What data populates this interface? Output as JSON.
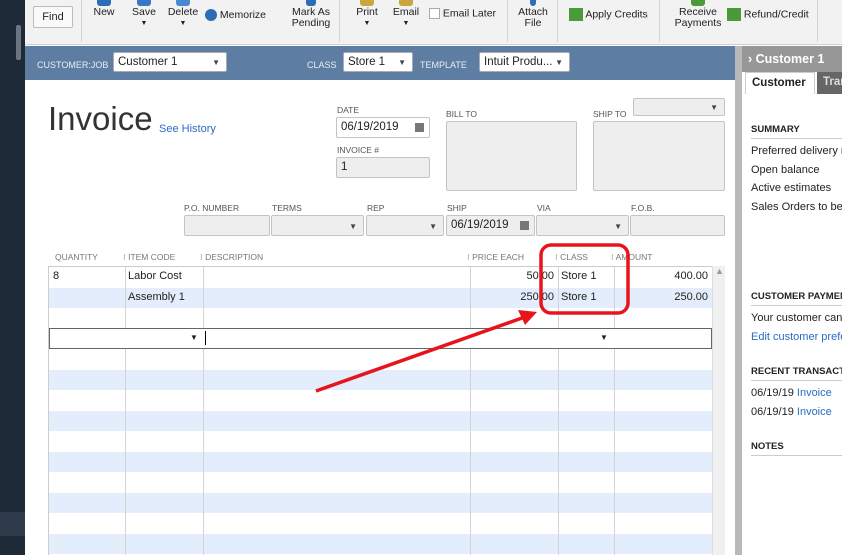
{
  "toolbar": {
    "find": "Find",
    "new": "New",
    "save": "Save",
    "delete": "Delete",
    "memorize": "Memorize",
    "mark_as_pending": [
      "Mark As",
      "Pending"
    ],
    "print": "Print",
    "email": "Email",
    "email_later": "Email Later",
    "attach_file": [
      "Attach",
      "File"
    ],
    "apply_credits": "Apply Credits",
    "receive_payments": [
      "Receive",
      "Payments"
    ],
    "refund_credit": "Refund/Credit"
  },
  "header": {
    "customer_job_label": "CUSTOMER:JOB",
    "customer_job": "Customer 1",
    "class_label": "CLASS",
    "class": "Store 1",
    "template_label": "TEMPLATE",
    "template": "Intuit Produ..."
  },
  "form": {
    "title": "Invoice",
    "see_history": "See History",
    "date_label": "DATE",
    "date": "06/19/2019",
    "invoice_no_label": "INVOICE #",
    "invoice_no": "1",
    "bill_to_label": "BILL TO",
    "ship_to_label": "SHIP TO",
    "po_label": "P.O. NUMBER",
    "terms_label": "TERMS",
    "rep_label": "REP",
    "ship_label": "SHIP",
    "ship_date": "06/19/2019",
    "via_label": "VIA",
    "fob_label": "F.O.B."
  },
  "table": {
    "headers": [
      "QUANTITY",
      "ITEM CODE",
      "DESCRIPTION",
      "PRICE EACH",
      "CLASS",
      "AMOUNT"
    ],
    "rows": [
      {
        "qty": "8",
        "item": "Labor Cost",
        "desc": "",
        "price": "50.00",
        "class": "Store 1",
        "amount": "400.00"
      },
      {
        "qty": "",
        "item": "Assembly 1",
        "desc": "",
        "price": "250.00",
        "class": "Store 1",
        "amount": "250.00"
      }
    ]
  },
  "right_panel": {
    "title": "Customer 1",
    "tabs": [
      "Customer",
      "Transaction"
    ],
    "summary_heading": "SUMMARY",
    "summary": [
      "Preferred delivery method",
      "Open balance",
      "Active estimates",
      "Sales Orders to be invoiced"
    ],
    "payments_heading": "CUSTOMER PAYMENTS",
    "payments_text": "Your customer can pay online",
    "payments_link": "Edit customer preferences",
    "recent_heading": "RECENT TRANSACTIONS",
    "recent": [
      {
        "date": "06/19/19",
        "type": "Invoice"
      },
      {
        "date": "06/19/19",
        "type": "Invoice"
      }
    ],
    "notes_heading": "NOTES"
  },
  "annotation_color": "#e8141b"
}
